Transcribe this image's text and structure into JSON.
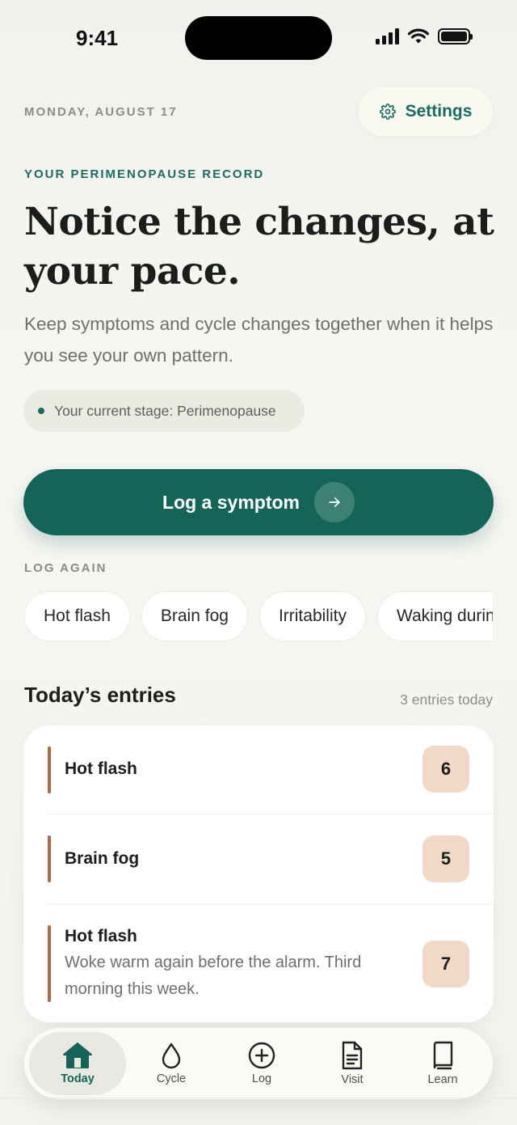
{
  "status_bar": {
    "time": "9:41"
  },
  "header": {
    "date": "MONDAY, AUGUST 17",
    "settings_label": "Settings"
  },
  "hero": {
    "kicker": "YOUR PERIMENOPAUSE RECORD",
    "headline": "Notice the changes, at your pace.",
    "subcopy": "Keep symptoms and cycle changes together when it helps you see your own pattern.",
    "stage": "Your current stage: Perimenopause"
  },
  "primary_action": {
    "label": "Log a symptom"
  },
  "log_again": {
    "heading": "LOG AGAIN",
    "chips": [
      "Hot flash",
      "Brain fog",
      "Irritability",
      "Waking during the night"
    ]
  },
  "entries": {
    "title": "Today’s entries",
    "count": "3 entries today",
    "items": [
      {
        "name": "Hot flash",
        "score": "6",
        "note": ""
      },
      {
        "name": "Brain fog",
        "score": "5",
        "note": ""
      },
      {
        "name": "Hot flash",
        "score": "7",
        "note": "Woke warm again before the alarm. Third morning this week."
      }
    ]
  },
  "tabbar": {
    "tabs": [
      {
        "label": "Today",
        "icon": "home-icon",
        "active": true
      },
      {
        "label": "Cycle",
        "icon": "drop-icon",
        "active": false
      },
      {
        "label": "Log",
        "icon": "plus-circle-icon",
        "active": false
      },
      {
        "label": "Visit",
        "icon": "document-icon",
        "active": false
      },
      {
        "label": "Learn",
        "icon": "book-icon",
        "active": false
      }
    ]
  },
  "colors": {
    "brand_green": "#146558",
    "accent_text_green": "#1d6b5f",
    "entry_bar": "#b5684a",
    "score_badge": "#f1d8c8"
  }
}
